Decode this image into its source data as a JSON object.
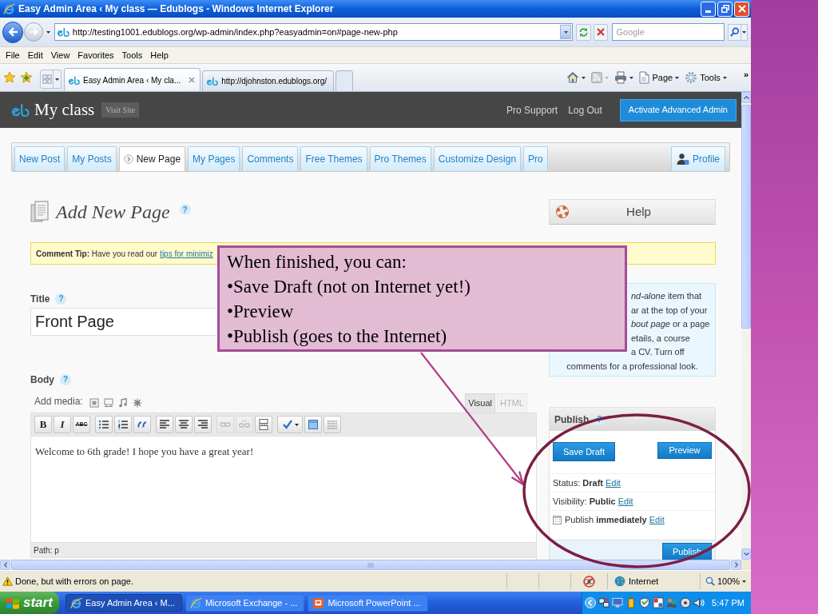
{
  "window": {
    "title": "Easy Admin Area ‹ My class — Edublogs - Windows Internet Explorer"
  },
  "address_bar": {
    "url": "http://testing1001.edublogs.org/wp-admin/index.php?easyadmin=on#page-new-php"
  },
  "search": {
    "placeholder": "Google"
  },
  "menu_bar": [
    "File",
    "Edit",
    "View",
    "Favorites",
    "Tools",
    "Help"
  ],
  "browser_tabs": [
    {
      "label": "Easy Admin Area ‹ My cla...",
      "selected": true
    },
    {
      "label": "http://djohnston.edublogs.org/",
      "selected": false
    }
  ],
  "command_bar": {
    "items": [
      {
        "kind": "home"
      },
      {
        "kind": "feeds"
      },
      {
        "kind": "print"
      },
      {
        "kind": "page",
        "label": "Page"
      },
      {
        "kind": "tools",
        "label": "Tools"
      }
    ],
    "overflow": "»"
  },
  "site_header": {
    "site_name": "My class",
    "visit_site": "Visit Site",
    "links": [
      "Pro Support",
      "Log Out"
    ],
    "button": "Activate Advanced Admin"
  },
  "admin_tabs": [
    {
      "label": "New Post",
      "selected": false
    },
    {
      "label": "My Posts",
      "selected": false
    },
    {
      "label": "New Page",
      "selected": true
    },
    {
      "label": "My Pages",
      "selected": false
    },
    {
      "label": "Comments",
      "selected": false
    },
    {
      "label": "Free Themes",
      "selected": false
    },
    {
      "label": "Pro Themes",
      "selected": false
    },
    {
      "label": "Customize Design",
      "selected": false
    },
    {
      "label": "Pro",
      "selected": false
    }
  ],
  "profile": {
    "label": "Profile"
  },
  "page_heading": {
    "title": "Add New Page",
    "help": "?"
  },
  "help_box": {
    "label": "Help"
  },
  "tip": {
    "text": "**Comment Tip:** Have you read our",
    "link": "tips for minimiz"
  },
  "title_field": {
    "label": "Title",
    "help": "?",
    "value": "Front Page"
  },
  "body_field": {
    "label": "Body",
    "help": "?",
    "add_media": "Add media:",
    "media_buttons": [
      {
        "kind": "image"
      },
      {
        "kind": "video"
      },
      {
        "kind": "audio"
      },
      {
        "kind": "media"
      }
    ],
    "editor_tabs": [
      {
        "label": "Visual",
        "selected": true
      },
      {
        "label": "HTML",
        "selected": false
      }
    ],
    "toolbar": [
      [
        {
          "kind": "bold",
          "label": "B",
          "disabled": false
        },
        {
          "kind": "italic",
          "label": "I",
          "disabled": false
        },
        {
          "kind": "strike",
          "label": "ABC",
          "disabled": false
        }
      ],
      [
        {
          "kind": "bullets",
          "disabled": false
        },
        {
          "kind": "numbers",
          "disabled": false
        },
        {
          "kind": "quote",
          "disabled": false
        }
      ],
      [
        {
          "kind": "left",
          "disabled": false
        },
        {
          "kind": "center",
          "disabled": false
        },
        {
          "kind": "right",
          "disabled": false
        }
      ],
      [
        {
          "kind": "link",
          "disabled": true
        },
        {
          "kind": "unlink",
          "disabled": true
        },
        {
          "kind": "more",
          "disabled": false
        }
      ],
      [
        {
          "kind": "spell",
          "disabled": false
        },
        {
          "kind": "fullscreen",
          "disabled": false
        },
        {
          "kind": "sink",
          "disabled": false
        }
      ]
    ],
    "content": "Welcome to 6th grade! I hope you have a great year!",
    "path": "Path: p"
  },
  "info_box": {
    "lines": [
      {
        "text": "*nd-alone* item that",
        "covered": true
      },
      {
        "text": "ar at the top of your",
        "covered": true
      },
      {
        "text": "*bout page* or a page",
        "covered": true
      },
      {
        "text": "etails, a course",
        "covered": true
      },
      {
        "text": "a CV. Turn off",
        "covered": true
      },
      {
        "text": "comments for a professional look.",
        "covered": false
      }
    ]
  },
  "publish_box": {
    "title": "Publish",
    "help": "?",
    "save_draft": "Save Draft",
    "preview": "Preview",
    "rows": [
      {
        "kind": "status",
        "text": "Status: **Draft**",
        "link": "Edit"
      },
      {
        "kind": "visibility",
        "text": "Visibility: **Public**",
        "link": "Edit"
      },
      {
        "kind": "schedule",
        "text": "Publish **immediately**",
        "link": "Edit"
      }
    ],
    "publish_button": "Publish"
  },
  "status_bar": {
    "message": "Done, but with errors on page.",
    "zone": "Internet",
    "zoom": "100%"
  },
  "taskbar": {
    "start": "start",
    "tasks": [
      {
        "kind": "browser",
        "label": "Easy Admin Area ‹ M...",
        "selected": true
      },
      {
        "kind": "browser",
        "label": "Microsoft Exchange - ...",
        "selected": false
      },
      {
        "kind": "slides",
        "label": "Microsoft PowerPoint ...",
        "selected": false
      }
    ],
    "clock": "5:47 PM"
  },
  "callout": {
    "lines": [
      "When finished, you can:",
      "•Save Draft (not on Internet yet!)",
      "•Preview",
      "•Publish (goes to the Internet)"
    ]
  }
}
